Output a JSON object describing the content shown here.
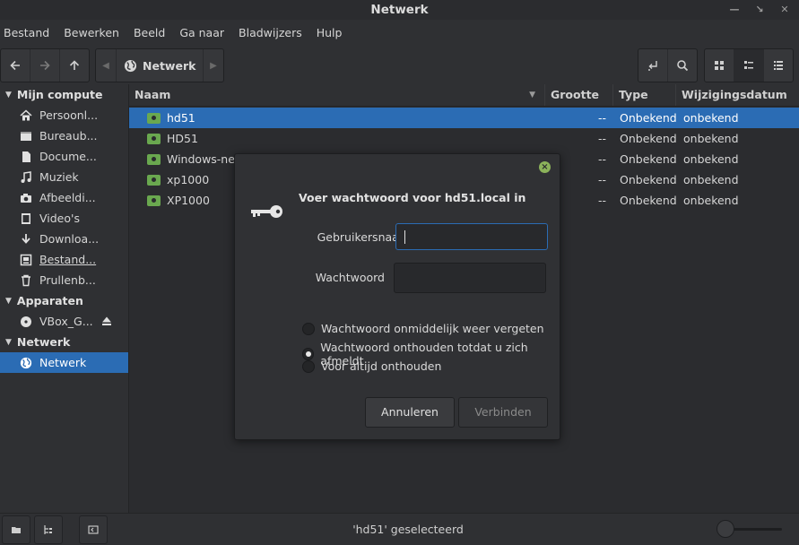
{
  "window": {
    "title": "Netwerk"
  },
  "menubar": {
    "items": [
      "Bestand",
      "Bewerken",
      "Beeld",
      "Ga naar",
      "Bladwijzers",
      "Hulp"
    ]
  },
  "pathbar": {
    "current": "Netwerk"
  },
  "sidebar": {
    "sections": [
      {
        "title": "Mijn compute",
        "items": [
          {
            "label": "Persoonl...",
            "icon": "home-icon"
          },
          {
            "label": "Bureaub...",
            "icon": "desktop-icon"
          },
          {
            "label": "Docume...",
            "icon": "document-icon"
          },
          {
            "label": "Muziek",
            "icon": "music-icon"
          },
          {
            "label": "Afbeeldi...",
            "icon": "camera-icon"
          },
          {
            "label": "Video's",
            "icon": "video-icon"
          },
          {
            "label": "Downloa...",
            "icon": "download-icon"
          },
          {
            "label": "Bestand...",
            "icon": "filesystem-icon"
          },
          {
            "label": "Prullenb...",
            "icon": "trash-icon"
          }
        ]
      },
      {
        "title": "Apparaten",
        "items": [
          {
            "label": "VBox_G...",
            "icon": "disc-icon"
          }
        ]
      },
      {
        "title": "Netwerk",
        "items": [
          {
            "label": "Netwerk",
            "icon": "network-icon"
          }
        ]
      }
    ]
  },
  "columns": {
    "name": "Naam",
    "size": "Grootte",
    "type": "Type",
    "date": "Wijzigingsdatum"
  },
  "files": [
    {
      "name": "hd51",
      "size": "--",
      "type": "Onbekend",
      "date": "onbekend"
    },
    {
      "name": "HD51",
      "size": "--",
      "type": "Onbekend",
      "date": "onbekend"
    },
    {
      "name": "Windows-netv",
      "size": "--",
      "type": "Onbekend",
      "date": "onbekend"
    },
    {
      "name": "xp1000",
      "size": "--",
      "type": "Onbekend",
      "date": "onbekend"
    },
    {
      "name": "XP1000",
      "size": "--",
      "type": "Onbekend",
      "date": "onbekend"
    }
  ],
  "status": {
    "text": "'hd51' geselecteerd"
  },
  "dialog": {
    "title": "Voer wachtwoord voor hd51.local in",
    "username_label": "Gebruikersnaam",
    "username_value": "",
    "password_label": "Wachtwoord",
    "password_value": "",
    "options": [
      "Wachtwoord onmiddelijk weer vergeten",
      "Wachtwoord onthouden totdat u zich afmeldt",
      "Voor altijd onthouden"
    ],
    "cancel_label": "Annuleren",
    "connect_label": "Verbinden"
  },
  "colors": {
    "accent": "#2b6cb4",
    "folder": "#6aa84f"
  }
}
